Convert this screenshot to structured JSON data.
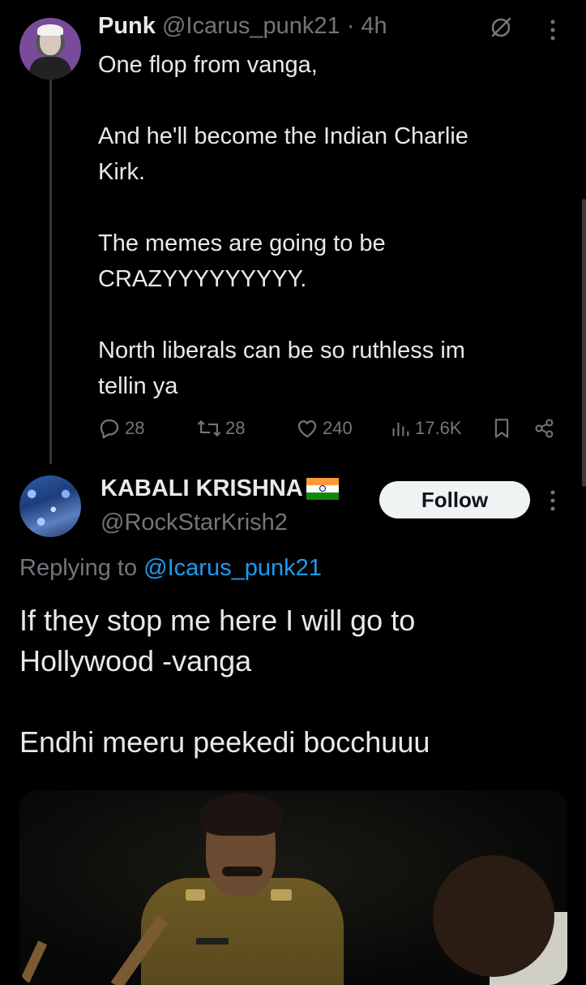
{
  "tweet1": {
    "name": "Punk",
    "handle_time": "@Icarus_punk21 · 4h",
    "body": [
      "One flop from vanga,",
      "",
      "And he'll become the Indian Charlie",
      "Kirk.",
      "",
      "The memes are going to be",
      "CRAZYYYYYYYYY.",
      "",
      "North liberals can be so ruthless im",
      "tellin ya"
    ],
    "actions": {
      "replies": "28",
      "reposts": "28",
      "likes": "240",
      "views": "17.6K"
    },
    "icons": [
      "grok-icon",
      "more-icon",
      "reply-icon",
      "repost-icon",
      "like-icon",
      "views-icon",
      "bookmark-icon",
      "share-icon"
    ]
  },
  "tweet2": {
    "name": "KABALI KRISHNA",
    "handle": "@RockStarKrish2",
    "follow_label": "Follow",
    "replying_prefix": "Replying to ",
    "replying_mention": "@Icarus_punk21",
    "body": [
      "If they stop me here I will go to",
      "Hollywood -vanga",
      "",
      "Endhi meeru peekedi bocchuuu"
    ]
  },
  "colors": {
    "background": "#000000",
    "text": "#e7e9ea",
    "secondary": "#71767b",
    "link": "#1d9bf0",
    "follow_bg": "#eff3f4"
  }
}
